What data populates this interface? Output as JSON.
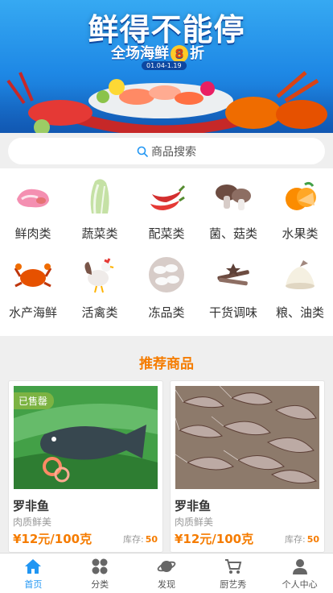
{
  "banner": {
    "title": "鲜得不能停",
    "subtitle_prefix": "全场海鲜",
    "subtitle_number": "8",
    "subtitle_suffix": "折",
    "date_range": "01.04-1.19"
  },
  "search": {
    "label": "商品搜索"
  },
  "categories": [
    {
      "label": "鲜肉类",
      "icon": "meat-icon"
    },
    {
      "label": "蔬菜类",
      "icon": "cabbage-icon"
    },
    {
      "label": "配菜类",
      "icon": "chili-icon"
    },
    {
      "label": "菌、菇类",
      "icon": "mushroom-icon"
    },
    {
      "label": "水果类",
      "icon": "orange-icon"
    },
    {
      "label": "水产海鲜",
      "icon": "crab-icon"
    },
    {
      "label": "活禽类",
      "icon": "rooster-icon"
    },
    {
      "label": "冻品类",
      "icon": "dumpling-icon"
    },
    {
      "label": "干货调味",
      "icon": "spice-icon"
    },
    {
      "label": "粮、油类",
      "icon": "rice-icon"
    }
  ],
  "recommend": {
    "title": "推荐商品",
    "products": [
      {
        "name": "罗非鱼",
        "desc": "肉质鲜美",
        "price": "¥12元/100克",
        "stock_label": "库存:",
        "stock_value": "50",
        "badge": "已售罄",
        "image": "fish-photo"
      },
      {
        "name": "罗非鱼",
        "desc": "肉质鲜美",
        "price": "¥12元/100克",
        "stock_label": "库存:",
        "stock_value": "50",
        "badge": "",
        "image": "shrimp-photo"
      }
    ]
  },
  "tabbar": [
    {
      "label": "首页",
      "icon": "home-icon",
      "active": true
    },
    {
      "label": "分类",
      "icon": "category-icon",
      "active": false
    },
    {
      "label": "发现",
      "icon": "planet-icon",
      "active": false
    },
    {
      "label": "厨艺秀",
      "icon": "cart-icon",
      "active": false
    },
    {
      "label": "个人中心",
      "icon": "user-icon",
      "active": false
    }
  ],
  "colors": {
    "accent": "#f57c00",
    "active_tab": "#2196f3",
    "sold_badge": "#7cb342"
  }
}
